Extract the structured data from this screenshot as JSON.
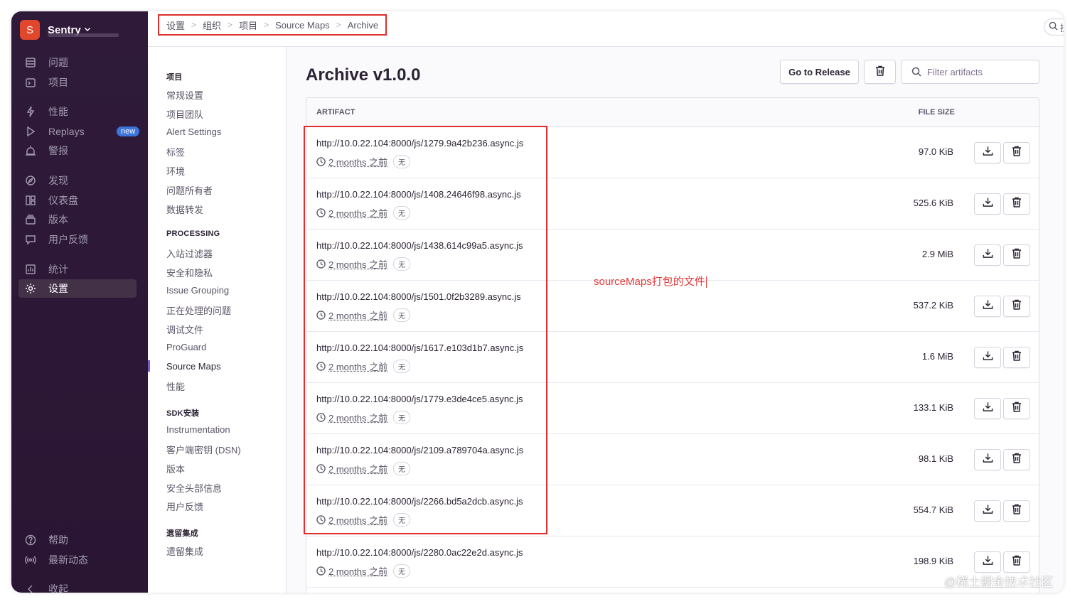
{
  "sidebar": {
    "org_initial": "S",
    "org_name": "Sentry",
    "new_badge": "new",
    "items": [
      {
        "label": "问题",
        "icon": "issues-icon"
      },
      {
        "label": "项目",
        "icon": "projects-icon"
      },
      {
        "label": "性能",
        "icon": "performance-icon"
      },
      {
        "label": "Replays",
        "icon": "replays-icon"
      },
      {
        "label": "警报",
        "icon": "alerts-icon"
      },
      {
        "label": "发现",
        "icon": "discover-icon"
      },
      {
        "label": "仪表盘",
        "icon": "dashboards-icon"
      },
      {
        "label": "版本",
        "icon": "releases-icon"
      },
      {
        "label": "用户反馈",
        "icon": "user-feedback-icon"
      },
      {
        "label": "统计",
        "icon": "stats-icon"
      },
      {
        "label": "设置",
        "icon": "settings-icon"
      }
    ],
    "bottom": [
      {
        "label": "帮助",
        "icon": "help-icon"
      },
      {
        "label": "最新动态",
        "icon": "broadcast-icon"
      },
      {
        "label": "收起",
        "icon": "collapse-icon"
      }
    ]
  },
  "breadcrumb": [
    "设置",
    "组织",
    "项目",
    "Source Maps",
    "Archive"
  ],
  "top_search_text": "搜",
  "settings_nav": {
    "sections": [
      {
        "title": "项目",
        "links": [
          "常规设置",
          "项目团队",
          "Alert Settings",
          "标签",
          "环境",
          "问题所有者",
          "数据转发"
        ]
      },
      {
        "title": "PROCESSING",
        "links": [
          "入站过滤器",
          "安全和隐私",
          "Issue Grouping",
          "正在处理的问题",
          "调试文件",
          "ProGuard",
          "Source Maps",
          "性能"
        ]
      },
      {
        "title": "SDK安装",
        "links": [
          "Instrumentation",
          "客户端密钥 (DSN)",
          "版本",
          "安全头部信息",
          "用户反馈"
        ]
      },
      {
        "title": "遗留集成",
        "links": [
          "遗留集成"
        ]
      }
    ],
    "active": "Source Maps"
  },
  "main": {
    "title": "Archive v1.0.0",
    "go_to_release": "Go to Release",
    "filter_placeholder": "Filter artifacts",
    "columns": {
      "artifact": "ARTIFACT",
      "file_size": "FILE SIZE"
    },
    "rows": [
      {
        "url": "http://10.0.22.104:8000/js/1279.9a42b236.async.js",
        "when": "2 months 之前",
        "tag": "无",
        "size": "97.0 KiB"
      },
      {
        "url": "http://10.0.22.104:8000/js/1408.24646f98.async.js",
        "when": "2 months 之前",
        "tag": "无",
        "size": "525.6 KiB"
      },
      {
        "url": "http://10.0.22.104:8000/js/1438.614c99a5.async.js",
        "when": "2 months 之前",
        "tag": "无",
        "size": "2.9 MiB"
      },
      {
        "url": "http://10.0.22.104:8000/js/1501.0f2b3289.async.js",
        "when": "2 months 之前",
        "tag": "无",
        "size": "537.2 KiB"
      },
      {
        "url": "http://10.0.22.104:8000/js/1617.e103d1b7.async.js",
        "when": "2 months 之前",
        "tag": "无",
        "size": "1.6 MiB"
      },
      {
        "url": "http://10.0.22.104:8000/js/1779.e3de4ce5.async.js",
        "when": "2 months 之前",
        "tag": "无",
        "size": "133.1 KiB"
      },
      {
        "url": "http://10.0.22.104:8000/js/2109.a789704a.async.js",
        "when": "2 months 之前",
        "tag": "无",
        "size": "98.1 KiB"
      },
      {
        "url": "http://10.0.22.104:8000/js/2266.bd5a2dcb.async.js",
        "when": "2 months 之前",
        "tag": "无",
        "size": "554.7 KiB"
      },
      {
        "url": "http://10.0.22.104:8000/js/2280.0ac22e2d.async.js",
        "when": "2 months 之前",
        "tag": "无",
        "size": "198.9 KiB"
      }
    ]
  },
  "annotation": "sourceMaps打包的文件",
  "watermark": "@稀土掘金技术社区",
  "colors": {
    "sidebar_bg": "#2f1a3a",
    "accent": "#6c5fc7",
    "annotation_red": "#e02d2d",
    "org_logo": "#e1472d",
    "new_badge": "#3d74db"
  }
}
